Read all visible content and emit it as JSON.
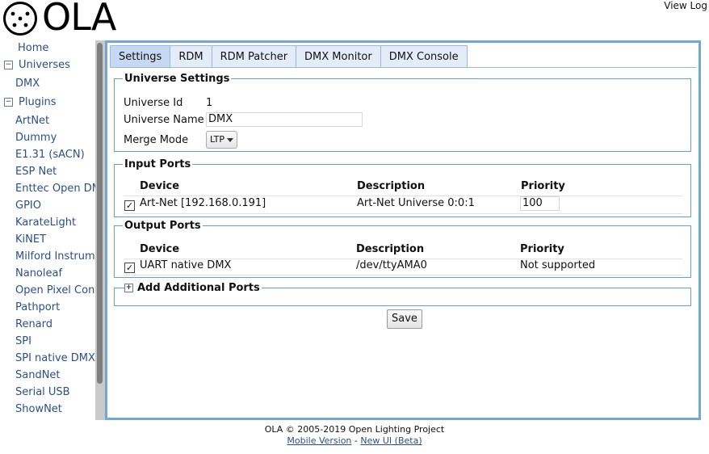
{
  "header": {
    "logo_text": "OLA",
    "view_log": "View Log"
  },
  "sidebar": {
    "home": "Home",
    "universes_label": "Universes",
    "universes_toggle": "−",
    "universes": [
      "DMX"
    ],
    "plugins_label": "Plugins",
    "plugins_toggle": "−",
    "plugins": [
      "ArtNet",
      "Dummy",
      "E1.31 (sACN)",
      "ESP Net",
      "Enttec Open DMX",
      "GPIO",
      "KarateLight",
      "KiNET",
      "Milford Instruments",
      "Nanoleaf",
      "Open Pixel Control",
      "Pathport",
      "Renard",
      "SPI",
      "SPI native DMX",
      "SandNet",
      "Serial USB",
      "ShowNet"
    ]
  },
  "tabs": [
    "Settings",
    "RDM",
    "RDM Patcher",
    "DMX Monitor",
    "DMX Console"
  ],
  "universe_settings": {
    "legend": "Universe Settings",
    "id_label": "Universe Id",
    "id_value": "1",
    "name_label": "Universe Name",
    "name_value": "DMX",
    "merge_label": "Merge Mode",
    "merge_value": "LTP"
  },
  "input_ports": {
    "legend": "Input Ports",
    "headers": {
      "device": "Device",
      "description": "Description",
      "priority": "Priority"
    },
    "rows": [
      {
        "device": "Art-Net [192.168.0.191]",
        "description": "Art-Net Universe 0:0:1",
        "priority": "100",
        "checked": true
      }
    ]
  },
  "output_ports": {
    "legend": "Output Ports",
    "headers": {
      "device": "Device",
      "description": "Description",
      "priority": "Priority"
    },
    "rows": [
      {
        "device": "UART native DMX",
        "description": "/dev/ttyAMA0",
        "priority": "Not supported",
        "checked": true
      }
    ]
  },
  "additional_ports": {
    "legend": "Add Additional Ports",
    "toggle": "+"
  },
  "save_label": "Save",
  "footer": {
    "copyright": "OLA © 2005-2019 Open Lighting Project",
    "mobile_link": "Mobile Version",
    "separator": "-",
    "new_ui_link": "New UI (Beta)"
  },
  "colors": {
    "accent": "#72a6d6",
    "link": "#2a4f8a",
    "fieldset_border": "#62a4c8"
  }
}
